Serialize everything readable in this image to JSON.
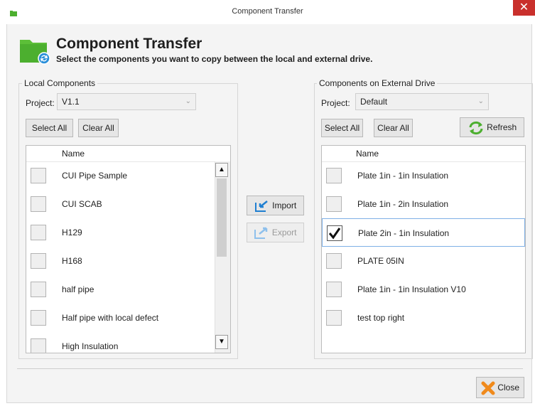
{
  "window": {
    "title": "Component Transfer",
    "close_glyph": "✕"
  },
  "header": {
    "title": "Component Transfer",
    "subtitle": "Select the components you want to copy between the local and external drive.",
    "icon": "folder-sync-icon"
  },
  "local": {
    "group_label": "Local Components",
    "project_label": "Project:",
    "project_value": "V1.1",
    "select_all": "Select All",
    "clear_all": "Clear All",
    "column_name": "Name",
    "items": [
      {
        "label": "CUI Pipe Sample",
        "checked": false
      },
      {
        "label": "CUI SCAB",
        "checked": false
      },
      {
        "label": "H129",
        "checked": false
      },
      {
        "label": "H168",
        "checked": false
      },
      {
        "label": "half pipe",
        "checked": false
      },
      {
        "label": "Half pipe with local defect",
        "checked": false
      },
      {
        "label": "High Insulation",
        "checked": false
      }
    ]
  },
  "transfer": {
    "import_label": "Import",
    "export_label": "Export"
  },
  "external": {
    "group_label": "Components on External Drive",
    "project_label": "Project:",
    "project_value": "Default",
    "select_all": "Select All",
    "clear_all": "Clear All",
    "refresh": "Refresh",
    "column_name": "Name",
    "items": [
      {
        "label": "Plate 1in - 1in Insulation",
        "checked": false
      },
      {
        "label": "Plate 1in - 2in Insulation",
        "checked": false
      },
      {
        "label": "Plate 2in - 1in Insulation",
        "checked": true
      },
      {
        "label": "PLATE 05IN",
        "checked": false
      },
      {
        "label": "Plate 1in - 1in Insulation V10",
        "checked": false
      },
      {
        "label": "test top right",
        "checked": false
      }
    ]
  },
  "footer": {
    "close_label": "Close"
  },
  "colors": {
    "accent_green": "#4caf2f",
    "close_red": "#c9302c",
    "import_blue": "#1f7fd1",
    "selection_border": "#7fb0e6",
    "close_orange": "#f08a1c"
  }
}
